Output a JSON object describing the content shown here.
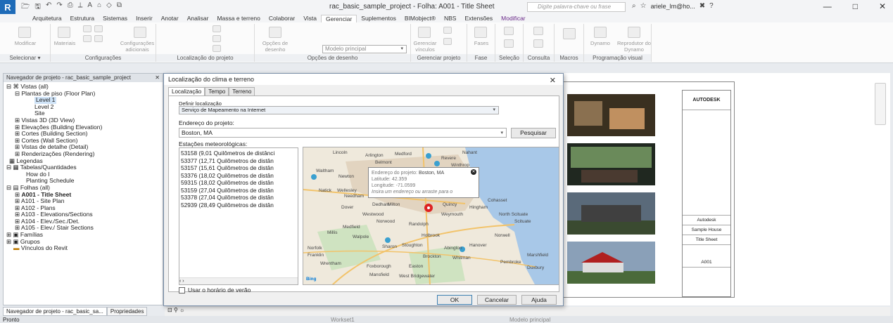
{
  "titlebar": {
    "logo": "R",
    "title": "rac_basic_sample_project - Folha: A001 - Title Sheet",
    "search_placeholder": "Digite palavra-chave ou frase",
    "user": "ariele_lm@ho...",
    "help": "?",
    "minimize": "—",
    "maximize": "□",
    "close": "✕"
  },
  "ribbon": {
    "tabs": [
      "Arquitetura",
      "Estrutura",
      "Sistemas",
      "Inserir",
      "Anotar",
      "Analisar",
      "Massa e terreno",
      "Colaborar",
      "Vista",
      "Gerenciar",
      "Suplementos",
      "BIMobject®",
      "NBS",
      "Extensões",
      "Modificar"
    ],
    "active_tab": "Gerenciar",
    "groups": {
      "selecionar": "Selecionar ▾",
      "configuracoes": "Configurações",
      "localizacao": "Localização do projeto",
      "opcoes": "Opções de desenho",
      "gerenciar_projeto": "Gerenciar projeto",
      "fase": "Fase",
      "selecao": "Seleção",
      "consulta": "Consulta",
      "macros": "Macros",
      "programacao": "Programação visual"
    },
    "buttons": {
      "modificar": "Modificar",
      "materiais": "Materiais",
      "config_adicionais": "Configurações adicionais",
      "opcoes_desenho": "Opções de desenho",
      "modelo_principal": "Modelo principal",
      "gerenciar_vinculos": "Gerenciar vínculos",
      "fases": "Fases",
      "dynamo": "Dynamo",
      "reprodutor": "Reprodutor do Dynamo"
    }
  },
  "browser": {
    "title": "Navegador de projeto - rac_basic_sample_project",
    "items": [
      "Vistas (all)",
      "Plantas de piso (Floor Plan)",
      "Level 1",
      "Level 2",
      "Site",
      "Vistas 3D (3D View)",
      "Elevações (Building Elevation)",
      "Cortes (Building Section)",
      "Cortes (Wall Section)",
      "Vistas de detalhe (Detail)",
      "Renderizações (Rendering)",
      "Legendas",
      "Tabelas/Quantidades",
      "How do I",
      "Planting Schedule",
      "Folhas (all)",
      "A001 - Title Sheet",
      "A101 - Site Plan",
      "A102 - Plans",
      "A103 - Elevations/Sections",
      "A104 - Elev./Sec./Det.",
      "A105 - Elev./ Stair Sections",
      "Famílias",
      "Grupos",
      "Vínculos do Revit"
    ],
    "tab_browser": "Navegador de projeto - rac_basic_sa...",
    "tab_props": "Propriedades"
  },
  "dialog": {
    "title": "Localização do clima e terreno",
    "tabs": [
      "Localização",
      "Tempo",
      "Terreno"
    ],
    "define_label": "Definir localização",
    "define_value": "Serviço de Mapeamento na Internet",
    "address_label": "Endereço do projeto:",
    "address_value": "Boston, MA",
    "search_button": "Pesquisar",
    "stations_label": "Estações meteorológicas:",
    "stations": [
      "53158 (9,01 Quilômetros de distânci",
      "53377 (12,71 Quilômetros de distân",
      "53157 (15,61 Quilômetros de distân",
      "53376 (18,02 Quilômetros de distân",
      "59315 (18,02 Quilômetros de distân",
      "53159 (27,04 Quilômetros de distân",
      "53378 (27,04 Quilômetros de distân",
      "52939 (28,49 Quilômetros de distân"
    ],
    "popup": {
      "address_k": "Endereço do projeto:",
      "address_v": "Boston, MA",
      "lat_k": "Latitude:",
      "lat_v": "42.359",
      "lon_k": "Longitude:",
      "lon_v": "-71.0599",
      "hint": "Insira um endereço ou arraste para o"
    },
    "map_labels": [
      "Lincoln",
      "Arlington",
      "Medford",
      "Revere",
      "Nahant",
      "Belmont",
      "Winthrop",
      "Waltham",
      "Newton",
      "Natick",
      "Wellesley",
      "Needham",
      "Dover",
      "Dedham",
      "Milton",
      "Quincy",
      "Hingham",
      "Cohasset",
      "Westwood",
      "Weymouth",
      "North Scituate",
      "Norwood",
      "Randolph",
      "Scituate",
      "Medfield",
      "Walpole",
      "Holbrook",
      "Norwell",
      "Millis",
      "Sharon",
      "Stoughton",
      "Abington",
      "Hanover",
      "Norfolk",
      "Franklin",
      "Brockton",
      "Whitman",
      "Marshfield",
      "Pembroke",
      "Wrentham",
      "Foxborough",
      "Easton",
      "Mansfield",
      "West Bridgewater",
      "Duxbury",
      "Bing"
    ],
    "map_colors": {
      "land": "#efe9dc",
      "water": "#a8c8e8",
      "urban": "#e2d4c0",
      "road": "#f2c36a",
      "green": "#cfe3c1"
    },
    "local_time_label": "Usar o horário de verão",
    "ok": "OK",
    "cancel": "Cancelar",
    "help": "Ajuda"
  },
  "sheet": {
    "autodesk": "AUTODESK",
    "company": "Autodesk",
    "project": "Sample House",
    "sheet_name": "Title Sheet",
    "sheet_number": "A001"
  },
  "status": {
    "ready": "Pronto",
    "workset": "Workset1",
    "model": "Modelo principal"
  }
}
